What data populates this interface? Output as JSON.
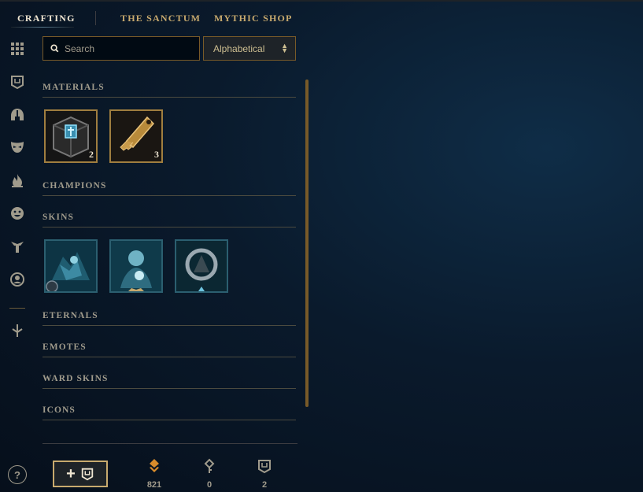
{
  "nav": {
    "tabs": [
      {
        "label": "CRAFTING",
        "active": true
      },
      {
        "label": "THE SANCTUM",
        "active": false
      },
      {
        "label": "MYTHIC SHOP",
        "active": false
      }
    ]
  },
  "rail": {
    "icons": [
      "grid-icon",
      "loot-chest-icon",
      "helmet-icon",
      "mask-icon",
      "flame-icon",
      "emote-face-icon",
      "ward-icon",
      "profile-icon",
      "arrow-down-icon"
    ],
    "help_label": "?"
  },
  "search": {
    "placeholder": "Search",
    "value": ""
  },
  "sort": {
    "selected": "Alphabetical"
  },
  "sections": {
    "materials": "MATERIALS",
    "champions": "CHAMPIONS",
    "skins": "SKINS",
    "eternals": "ETERNALS",
    "emotes": "EMOTES",
    "ward_skins": "WARD SKINS",
    "icons": "ICONS"
  },
  "materials": [
    {
      "name": "chest",
      "count": "2"
    },
    {
      "name": "key",
      "count": "3"
    }
  ],
  "skins": [
    {
      "name": "skin-shard-1"
    },
    {
      "name": "skin-shard-2"
    },
    {
      "name": "skin-shard-3"
    }
  ],
  "footer": {
    "add_button_plus": "+",
    "currencies": [
      {
        "icon": "orange-essence-icon",
        "value": "821"
      },
      {
        "icon": "key-fragment-icon",
        "value": "0"
      },
      {
        "icon": "chest-icon",
        "value": "2"
      }
    ]
  },
  "colors": {
    "gold": "#c8aa6e",
    "dark_gold": "#785a28",
    "teal": "#2b5f70",
    "bg": "#0a1a2c"
  }
}
